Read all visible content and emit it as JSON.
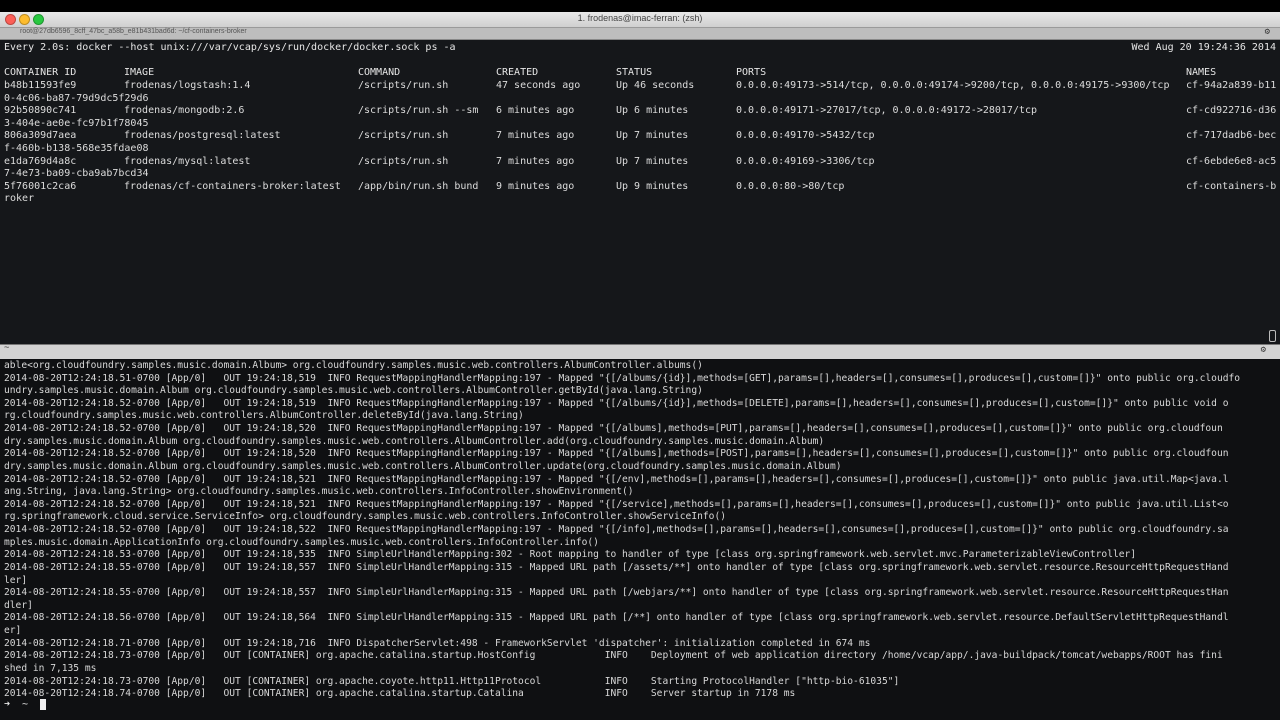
{
  "window": {
    "title": "1. frodenas@imac-ferran: (zsh)",
    "tab_label": "root@27db6596_8cff_47bc_a58b_e81b431bad6d: ~/cf-containers-broker",
    "tab_gear": "⚙",
    "divider_label": "~",
    "divider_gear": "⚙"
  },
  "watch": {
    "command": "Every 2.0s: docker --host unix:///var/vcap/sys/run/docker/docker.sock ps -a",
    "timestamp": "Wed Aug 20 19:24:36 2014"
  },
  "containers": {
    "headers": [
      "CONTAINER ID",
      "IMAGE",
      "COMMAND",
      "CREATED",
      "STATUS",
      "PORTS",
      "NAMES"
    ],
    "rows": [
      {
        "id": "b48b11593fe9",
        "image": "frodenas/logstash:1.4",
        "command": "/scripts/run.sh",
        "created": "47 seconds ago",
        "status": "Up 46 seconds",
        "ports": "0.0.0.0:49173->514/tcp, 0.0.0.0:49174->9200/tcp, 0.0.0.0:49175->9300/tcp",
        "names": "cf-94a2a839-b11",
        "wrap": "0-4c06-ba87-79d9dc5f29d6"
      },
      {
        "id": "92b50890c741",
        "image": "frodenas/mongodb:2.6",
        "command": "/scripts/run.sh --sm",
        "created": "6 minutes ago",
        "status": "Up 6 minutes",
        "ports": "0.0.0.0:49171->27017/tcp, 0.0.0.0:49172->28017/tcp",
        "names": "cf-cd922716-d36",
        "wrap": "3-404e-ae0e-fc97b1f78045"
      },
      {
        "id": "806a309d7aea",
        "image": "frodenas/postgresql:latest",
        "command": "/scripts/run.sh",
        "created": "7 minutes ago",
        "status": "Up 7 minutes",
        "ports": "0.0.0.0:49170->5432/tcp",
        "names": "cf-717dadb6-bec",
        "wrap": "f-460b-b138-568e35fdae08"
      },
      {
        "id": "e1da769d4a8c",
        "image": "frodenas/mysql:latest",
        "command": "/scripts/run.sh",
        "created": "7 minutes ago",
        "status": "Up 7 minutes",
        "ports": "0.0.0.0:49169->3306/tcp",
        "names": "cf-6ebde6e8-ac5",
        "wrap": "7-4e73-ba09-cba9ab7bcd34"
      },
      {
        "id": "5f76001c2ca6",
        "image": "frodenas/cf-containers-broker:latest",
        "command": "/app/bin/run.sh bund",
        "created": "9 minutes ago",
        "status": "Up 9 minutes",
        "ports": "0.0.0.0:80->80/tcp",
        "names": "cf-containers-b",
        "wrap": "roker"
      }
    ]
  },
  "log": {
    "lines": [
      "able<org.cloudfoundry.samples.music.domain.Album> org.cloudfoundry.samples.music.web.controllers.AlbumController.albums()",
      "2014-08-20T12:24:18.51-0700 [App/0]   OUT 19:24:18,519  INFO RequestMappingHandlerMapping:197 - Mapped \"{[/albums/{id}],methods=[GET],params=[],headers=[],consumes=[],produces=[],custom=[]}\" onto public org.cloudfo",
      "undry.samples.music.domain.Album org.cloudfoundry.samples.music.web.controllers.AlbumController.getById(java.lang.String)",
      "2014-08-20T12:24:18.52-0700 [App/0]   OUT 19:24:18,519  INFO RequestMappingHandlerMapping:197 - Mapped \"{[/albums/{id}],methods=[DELETE],params=[],headers=[],consumes=[],produces=[],custom=[]}\" onto public void o",
      "rg.cloudfoundry.samples.music.web.controllers.AlbumController.deleteById(java.lang.String)",
      "2014-08-20T12:24:18.52-0700 [App/0]   OUT 19:24:18,520  INFO RequestMappingHandlerMapping:197 - Mapped \"{[/albums],methods=[PUT],params=[],headers=[],consumes=[],produces=[],custom=[]}\" onto public org.cloudfoun",
      "dry.samples.music.domain.Album org.cloudfoundry.samples.music.web.controllers.AlbumController.add(org.cloudfoundry.samples.music.domain.Album)",
      "2014-08-20T12:24:18.52-0700 [App/0]   OUT 19:24:18,520  INFO RequestMappingHandlerMapping:197 - Mapped \"{[/albums],methods=[POST],params=[],headers=[],consumes=[],produces=[],custom=[]}\" onto public org.cloudfoun",
      "dry.samples.music.domain.Album org.cloudfoundry.samples.music.web.controllers.AlbumController.update(org.cloudfoundry.samples.music.domain.Album)",
      "2014-08-20T12:24:18.52-0700 [App/0]   OUT 19:24:18,521  INFO RequestMappingHandlerMapping:197 - Mapped \"{[/env],methods=[],params=[],headers=[],consumes=[],produces=[],custom=[]}\" onto public java.util.Map<java.l",
      "ang.String, java.lang.String> org.cloudfoundry.samples.music.web.controllers.InfoController.showEnvironment()",
      "2014-08-20T12:24:18.52-0700 [App/0]   OUT 19:24:18,521  INFO RequestMappingHandlerMapping:197 - Mapped \"{[/service],methods=[],params=[],headers=[],consumes=[],produces=[],custom=[]}\" onto public java.util.List<o",
      "rg.springframework.cloud.service.ServiceInfo> org.cloudfoundry.samples.music.web.controllers.InfoController.showServiceInfo()",
      "2014-08-20T12:24:18.52-0700 [App/0]   OUT 19:24:18,522  INFO RequestMappingHandlerMapping:197 - Mapped \"{[/info],methods=[],params=[],headers=[],consumes=[],produces=[],custom=[]}\" onto public org.cloudfoundry.sa",
      "mples.music.domain.ApplicationInfo org.cloudfoundry.samples.music.web.controllers.InfoController.info()",
      "2014-08-20T12:24:18.53-0700 [App/0]   OUT 19:24:18,535  INFO SimpleUrlHandlerMapping:302 - Root mapping to handler of type [class org.springframework.web.servlet.mvc.ParameterizableViewController]",
      "2014-08-20T12:24:18.55-0700 [App/0]   OUT 19:24:18,557  INFO SimpleUrlHandlerMapping:315 - Mapped URL path [/assets/**] onto handler of type [class org.springframework.web.servlet.resource.ResourceHttpRequestHand",
      "ler]",
      "2014-08-20T12:24:18.55-0700 [App/0]   OUT 19:24:18,557  INFO SimpleUrlHandlerMapping:315 - Mapped URL path [/webjars/**] onto handler of type [class org.springframework.web.servlet.resource.ResourceHttpRequestHan",
      "dler]",
      "2014-08-20T12:24:18.56-0700 [App/0]   OUT 19:24:18,564  INFO SimpleUrlHandlerMapping:315 - Mapped URL path [/**] onto handler of type [class org.springframework.web.servlet.resource.DefaultServletHttpRequestHandl",
      "er]",
      "2014-08-20T12:24:18.71-0700 [App/0]   OUT 19:24:18,716  INFO DispatcherServlet:498 - FrameworkServlet 'dispatcher': initialization completed in 674 ms",
      "2014-08-20T12:24:18.73-0700 [App/0]   OUT [CONTAINER] org.apache.catalina.startup.HostConfig            INFO    Deployment of web application directory /home/vcap/app/.java-buildpack/tomcat/webapps/ROOT has fini",
      "shed in 7,135 ms",
      "2014-08-20T12:24:18.73-0700 [App/0]   OUT [CONTAINER] org.apache.coyote.http11.Http11Protocol           INFO    Starting ProtocolHandler [\"http-bio-61035\"]",
      "2014-08-20T12:24:18.74-0700 [App/0]   OUT [CONTAINER] org.apache.catalina.startup.Catalina              INFO    Server startup in 7178 ms"
    ],
    "prompt": "➜  ~ "
  }
}
